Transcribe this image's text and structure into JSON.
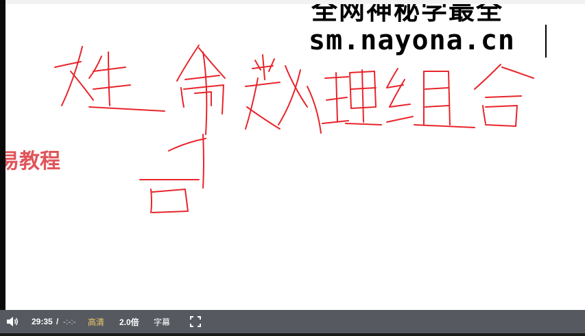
{
  "watermark": {
    "line1": "全网神秘学最全",
    "line2": "sm.nayona.cn"
  },
  "overlay": {
    "brand_text": "易教程"
  },
  "controls": {
    "current_time": "29:35",
    "separator": "/",
    "duration": "-:-:-",
    "quality_label": "高清",
    "speed_label": "2.0倍",
    "subtitle_label": "字幕"
  },
  "icons": {
    "volume": "speaker-icon",
    "fullscreen": "fullscreen-icon"
  },
  "colors": {
    "ink": "#e8242a",
    "brand": "#e0555a",
    "control_bar": "#565a60",
    "quality_accent": "#f3c96b"
  }
}
